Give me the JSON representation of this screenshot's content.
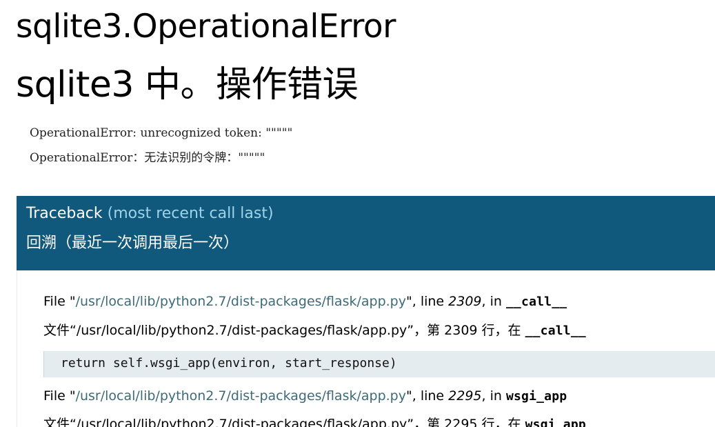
{
  "title": {
    "en": "sqlite3.OperationalError",
    "zh": "sqlite3 中。操作错误"
  },
  "error_message": {
    "en": "OperationalError: unrecognized token: \"\"\"\"\"",
    "zh": "OperationalError：无法识别的令牌：\"\"\"\"\""
  },
  "traceback": {
    "heading_en": "Traceback",
    "heading_en_detail": "(most recent call last)",
    "heading_zh": "回溯（最近一次调用最后一次）",
    "frames": [
      {
        "en_prefix": "File \"",
        "path": "/usr/local/lib/python2.7/dist-packages/flask/app.py",
        "en_mid": "\", line ",
        "line": "2309",
        "en_in": ", in ",
        "func": "__call__",
        "zh_prefix": "文件“",
        "zh_mid": "”，第 ",
        "zh_line_suffix": " 行，在 ",
        "code": "return self.wsgi_app(environ, start_response)"
      },
      {
        "en_prefix": "File \"",
        "path": "/usr/local/lib/python2.7/dist-packages/flask/app.py",
        "en_mid": "\", line ",
        "line": "2295",
        "en_in": ", in ",
        "func": "wsgi_app",
        "zh_prefix": "文件“",
        "zh_mid": "”，第 ",
        "zh_line_suffix": " 行，在 "
      }
    ]
  }
}
